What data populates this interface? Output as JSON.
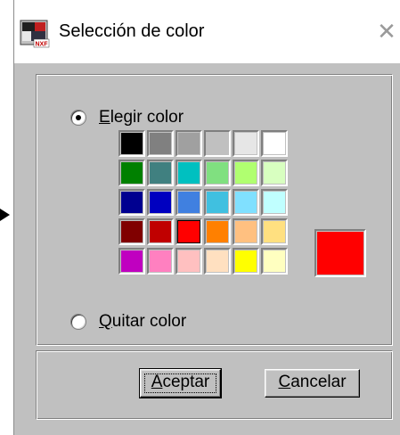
{
  "window": {
    "title": "Selección de color"
  },
  "options": {
    "choose_label_access": "E",
    "choose_label_rest": "legir color",
    "remove_label_access": "Q",
    "remove_label_rest": "uitar color"
  },
  "palette": {
    "rows": [
      [
        "#000000",
        "#808080",
        "#a0a0a0",
        "#c0c0c0",
        "#e6e6e6",
        "#ffffff"
      ],
      [
        "#008000",
        "#408080",
        "#00c0c0",
        "#80e080",
        "#b0ff70",
        "#d8ffc0"
      ],
      [
        "#000090",
        "#0000c0",
        "#4080e0",
        "#40c0e0",
        "#80e0ff",
        "#c0ffff"
      ],
      [
        "#800000",
        "#c00000",
        "#ff0000",
        "#ff8000",
        "#ffc080",
        "#ffe080"
      ],
      [
        "#c000c0",
        "#ff80c0",
        "#ffc0c0",
        "#ffe0c0",
        "#ffff00",
        "#ffffc0"
      ]
    ],
    "selected": {
      "row": 3,
      "col": 2
    },
    "preview_color": "#ff0000"
  },
  "buttons": {
    "accept_access": "A",
    "accept_rest": "ceptar",
    "cancel_access": "C",
    "cancel_rest": "ancelar"
  },
  "colors": {
    "dialog_bg": "#c0c0c0",
    "titlebar_bg": "#ffffff"
  }
}
